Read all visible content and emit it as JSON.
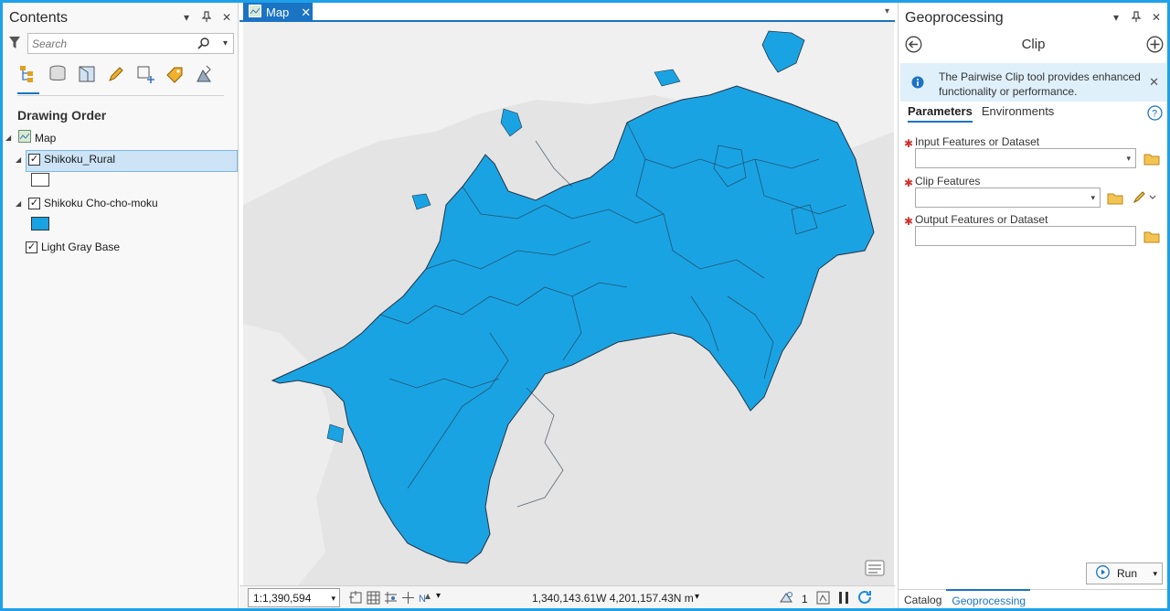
{
  "contents": {
    "title": "Contents",
    "search_placeholder": "Search",
    "section": "Drawing Order",
    "map_label": "Map",
    "layers": [
      {
        "name": "Shikoku_Rural",
        "checked": true,
        "swatch": "#ffffff"
      },
      {
        "name": "Shikoku Cho-cho-moku",
        "checked": true,
        "swatch": "#1aa3e3"
      },
      {
        "name": "Light Gray Base",
        "checked": true
      }
    ]
  },
  "map_view": {
    "tab_label": "Map",
    "scale": "1:1,390,594",
    "coordinates": "1,340,143.61W 4,201,157.43N m",
    "selected_count": "1",
    "land_color": "#1aa3e3",
    "base_color": "#e4e4e4"
  },
  "geoprocessing": {
    "title": "Geoprocessing",
    "tool": "Clip",
    "info": "The Pairwise Clip tool provides enhanced functionality or performance.",
    "tabs": [
      "Parameters",
      "Environments"
    ],
    "params": [
      "Input Features or Dataset",
      "Clip Features",
      "Output Features or Dataset"
    ],
    "run_label": "Run",
    "bottom_tabs": [
      "Catalog",
      "Geoprocessing"
    ]
  },
  "colors": {
    "accent": "#1b73c4",
    "frame": "#1fa0e8"
  }
}
